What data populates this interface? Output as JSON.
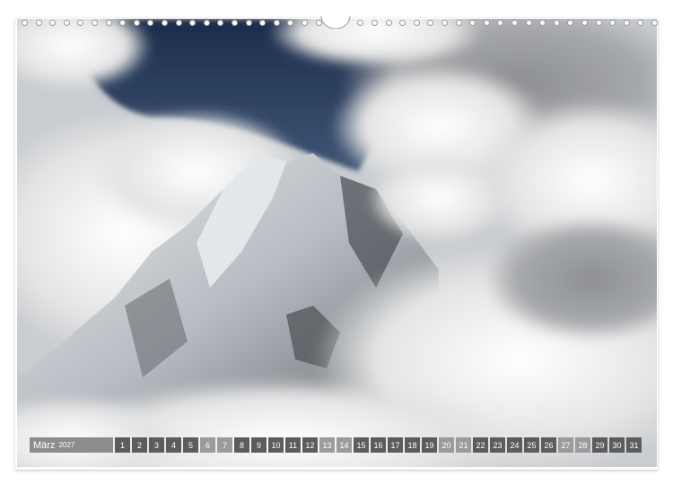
{
  "calendar": {
    "month": "März",
    "year": "2027",
    "days": [
      {
        "num": "1",
        "weekend": false
      },
      {
        "num": "2",
        "weekend": false
      },
      {
        "num": "3",
        "weekend": false
      },
      {
        "num": "4",
        "weekend": false
      },
      {
        "num": "5",
        "weekend": false
      },
      {
        "num": "6",
        "weekend": true
      },
      {
        "num": "7",
        "weekend": true
      },
      {
        "num": "8",
        "weekend": false
      },
      {
        "num": "9",
        "weekend": false
      },
      {
        "num": "10",
        "weekend": false
      },
      {
        "num": "11",
        "weekend": false
      },
      {
        "num": "12",
        "weekend": false
      },
      {
        "num": "13",
        "weekend": true
      },
      {
        "num": "14",
        "weekend": true
      },
      {
        "num": "15",
        "weekend": false
      },
      {
        "num": "16",
        "weekend": false
      },
      {
        "num": "17",
        "weekend": false
      },
      {
        "num": "18",
        "weekend": false
      },
      {
        "num": "19",
        "weekend": false
      },
      {
        "num": "20",
        "weekend": true
      },
      {
        "num": "21",
        "weekend": true
      },
      {
        "num": "22",
        "weekend": false
      },
      {
        "num": "23",
        "weekend": false
      },
      {
        "num": "24",
        "weekend": false
      },
      {
        "num": "25",
        "weekend": false
      },
      {
        "num": "26",
        "weekend": false
      },
      {
        "num": "27",
        "weekend": true
      },
      {
        "num": "28",
        "weekend": true
      },
      {
        "num": "29",
        "weekend": false
      },
      {
        "num": "30",
        "weekend": false
      },
      {
        "num": "31",
        "weekend": false
      }
    ]
  },
  "colors": {
    "weekday": "#5c5c5c",
    "weekend": "#9b9b9b",
    "month_label_bg": "#8c8c8c",
    "sky": "#1e3354"
  },
  "icons": {
    "binding": "spiral-binding-icon",
    "hanger": "hanger-hook-icon"
  }
}
